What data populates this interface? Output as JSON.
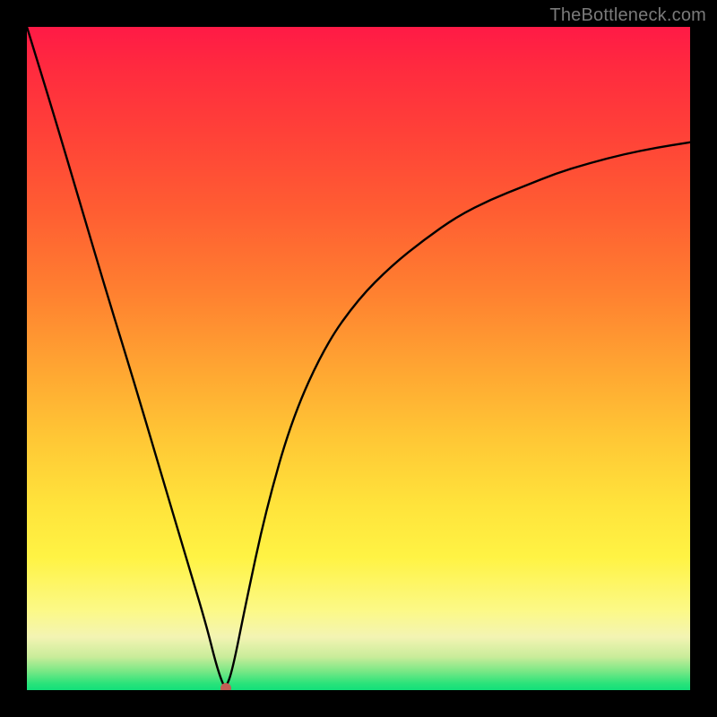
{
  "watermark": "TheBottleneck.com",
  "colors": {
    "frame": "#000000",
    "curve": "#000000",
    "marker": "#c15f55"
  },
  "chart_data": {
    "type": "line",
    "title": "",
    "xlabel": "",
    "ylabel": "",
    "xlim": [
      0,
      1
    ],
    "ylim": [
      0,
      1
    ],
    "grid": false,
    "legend": false,
    "marker": {
      "x": 0.3,
      "y": 0.003
    },
    "series": [
      {
        "name": "curve",
        "x": [
          0.0,
          0.04,
          0.08,
          0.12,
          0.16,
          0.2,
          0.24,
          0.27,
          0.285,
          0.295,
          0.3,
          0.31,
          0.33,
          0.36,
          0.4,
          0.45,
          0.5,
          0.55,
          0.6,
          0.65,
          0.7,
          0.75,
          0.8,
          0.85,
          0.9,
          0.95,
          1.0
        ],
        "y": [
          1.0,
          0.87,
          0.735,
          0.6,
          0.47,
          0.335,
          0.2,
          0.1,
          0.04,
          0.01,
          0.003,
          0.03,
          0.13,
          0.27,
          0.41,
          0.52,
          0.59,
          0.64,
          0.68,
          0.715,
          0.74,
          0.76,
          0.78,
          0.795,
          0.808,
          0.818,
          0.826
        ]
      }
    ]
  }
}
